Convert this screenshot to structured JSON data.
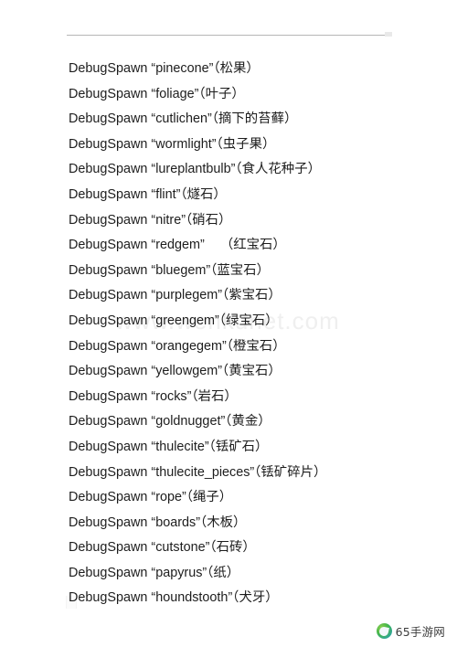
{
  "page": {
    "background_color": "#ffffff",
    "text_color": "#1d1d1d",
    "rule_color": "#b6b6b6"
  },
  "watermark": {
    "text": "www.wenkunet.com",
    "color": "#efefef"
  },
  "site_logo": {
    "icon": "globe-swoosh-icon",
    "text": "65手游网",
    "accent_color": "#45b649"
  },
  "commands": [
    {
      "keyword": "DebugSpawn",
      "name": "pinecone",
      "cn": "（松果）",
      "wide_gap": false
    },
    {
      "keyword": "DebugSpawn",
      "name": "foliage",
      "cn": "（叶子）",
      "wide_gap": false
    },
    {
      "keyword": "DebugSpawn",
      "name": "cutlichen",
      "cn": "（摘下的苔藓）",
      "wide_gap": false
    },
    {
      "keyword": "DebugSpawn",
      "name": "wormlight",
      "cn": "（虫子果）",
      "wide_gap": false
    },
    {
      "keyword": "DebugSpawn",
      "name": "lureplantbulb",
      "cn": "（食人花种子）",
      "wide_gap": false
    },
    {
      "keyword": "DebugSpawn",
      "name": "flint",
      "cn": "（燧石）",
      "wide_gap": false
    },
    {
      "keyword": "DebugSpawn",
      "name": "nitre",
      "cn": "（硝石）",
      "wide_gap": false
    },
    {
      "keyword": "DebugSpawn",
      "name": "redgem",
      "cn": "（红宝石）",
      "wide_gap": true
    },
    {
      "keyword": "DebugSpawn",
      "name": "bluegem",
      "cn": "（蓝宝石）",
      "wide_gap": false
    },
    {
      "keyword": "DebugSpawn",
      "name": "purplegem",
      "cn": "（紫宝石）",
      "wide_gap": false
    },
    {
      "keyword": "DebugSpawn",
      "name": "greengem",
      "cn": "（绿宝石）",
      "wide_gap": false
    },
    {
      "keyword": "DebugSpawn",
      "name": "orangegem",
      "cn": "（橙宝石）",
      "wide_gap": false
    },
    {
      "keyword": "DebugSpawn",
      "name": "yellowgem",
      "cn": "（黄宝石）",
      "wide_gap": false
    },
    {
      "keyword": "DebugSpawn",
      "name": "rocks",
      "cn": "（岩石）",
      "wide_gap": false
    },
    {
      "keyword": "DebugSpawn",
      "name": "goldnugget",
      "cn": "（黄金）",
      "wide_gap": false
    },
    {
      "keyword": "DebugSpawn",
      "name": "thulecite",
      "cn": "（铥矿石）",
      "wide_gap": false
    },
    {
      "keyword": "DebugSpawn",
      "name": "thulecite_pieces",
      "cn": "（铥矿碎片）",
      "wide_gap": false
    },
    {
      "keyword": "DebugSpawn",
      "name": "rope",
      "cn": "（绳子）",
      "wide_gap": false
    },
    {
      "keyword": "DebugSpawn",
      "name": "boards",
      "cn": "（木板）",
      "wide_gap": false
    },
    {
      "keyword": "DebugSpawn",
      "name": "cutstone",
      "cn": "（石砖）",
      "wide_gap": false
    },
    {
      "keyword": "DebugSpawn",
      "name": "papyrus",
      "cn": "（纸）",
      "wide_gap": false
    },
    {
      "keyword": "DebugSpawn",
      "name": "houndstooth",
      "cn": "（犬牙）",
      "wide_gap": false
    }
  ],
  "quotes": {
    "open": "“",
    "close": "”"
  }
}
